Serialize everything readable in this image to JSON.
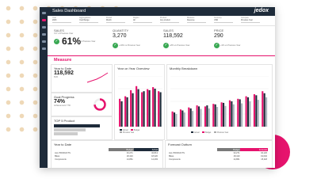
{
  "app": {
    "title": "Sales Dashboard",
    "logo": "jedox"
  },
  "filters": [
    {
      "label": "Year",
      "value": "2023"
    },
    {
      "label": "Aggregations",
      "value": "Year Range"
    },
    {
      "label": "Period",
      "value": "Month"
    },
    {
      "label": "Region",
      "value": "All"
    },
    {
      "label": "Product",
      "value": "Any product"
    },
    {
      "label": "Measure",
      "value": "Revenue"
    },
    {
      "label": "Currency",
      "value": "USD"
    },
    {
      "label": "Compare",
      "value": "Previous Year"
    }
  ],
  "kpis": [
    {
      "title": "SALES",
      "value": "",
      "sub": "YoY of Previous Year",
      "big": "61%",
      "note": "vs Previous Year"
    },
    {
      "title": "QUANTITY",
      "value": "3,270",
      "sub": "+10% vs Previous Year"
    },
    {
      "title": "SALES",
      "value": "118,592",
      "sub": "+8% vs Previous Year"
    },
    {
      "title": "PRICE",
      "value": "290",
      "sub": "+3% vs Previous Year"
    }
  ],
  "section": "Measure",
  "cards": {
    "ytd": {
      "title": "Year to Date",
      "value": "118,592",
      "pct": "81%"
    },
    "goal": {
      "title": "Goal Progress",
      "value": "74%",
      "note": "Achievement YTD"
    },
    "top5": {
      "title": "TOP 5 Product"
    },
    "overview": {
      "title": "Year on Year Overview",
      "legend": [
        "Actual",
        "Budget",
        "Previous Year"
      ]
    },
    "monthly": {
      "title": "Monthly Breakdown",
      "legend": [
        "Actual",
        "Budget",
        "Previous Year"
      ]
    }
  },
  "tables": {
    "ytd": {
      "title": "Year to Date",
      "cols": [
        "Budget",
        "Actual"
      ],
      "rows": [
        {
          "name": "ALL PRODUCTS",
          "b": "33,271",
          "a": "32,813"
        },
        {
          "name": "Bikes",
          "b": "18,410",
          "a": "18,320"
        },
        {
          "name": "Components",
          "b": "14,861",
          "a": "14,493"
        }
      ]
    },
    "forecast": {
      "title": "Forecast Outturn",
      "cols": [
        "Budget",
        "Forecast"
      ],
      "rows": [
        {
          "name": "ALL PRODUCTS",
          "b": "33,271",
          "a": "34,120"
        },
        {
          "name": "Bikes",
          "b": "18,410",
          "a": "19,002"
        },
        {
          "name": "Components",
          "b": "14,861",
          "a": "15,118"
        }
      ]
    }
  },
  "chart_data": [
    {
      "type": "bar",
      "title": "Year on Year Overview",
      "categories": [
        "1",
        "2",
        "3",
        "4",
        "5",
        "6",
        "7",
        "8"
      ],
      "series": [
        {
          "name": "Actual",
          "values": [
            55,
            60,
            72,
            80,
            68,
            74,
            78,
            70
          ]
        },
        {
          "name": "Budget",
          "values": [
            50,
            58,
            66,
            74,
            70,
            72,
            75,
            68
          ]
        }
      ]
    },
    {
      "type": "bar",
      "title": "Monthly Breakdown",
      "categories": [
        "1",
        "2",
        "3",
        "4",
        "5",
        "6",
        "7",
        "8",
        "9",
        "10",
        "11",
        "12"
      ],
      "series": [
        {
          "name": "Actual",
          "values": [
            30,
            34,
            38,
            42,
            40,
            45,
            48,
            52,
            55,
            60,
            64,
            70
          ]
        },
        {
          "name": "Budget",
          "values": [
            28,
            32,
            36,
            40,
            42,
            44,
            47,
            50,
            54,
            58,
            62,
            66
          ]
        },
        {
          "name": "Previous Year",
          "values": [
            25,
            28,
            31,
            35,
            36,
            39,
            41,
            44,
            46,
            50,
            53,
            58
          ]
        }
      ]
    }
  ],
  "colors": {
    "accent": "#e6136d",
    "navy": "#1e2b3a",
    "green": "#39a853"
  }
}
